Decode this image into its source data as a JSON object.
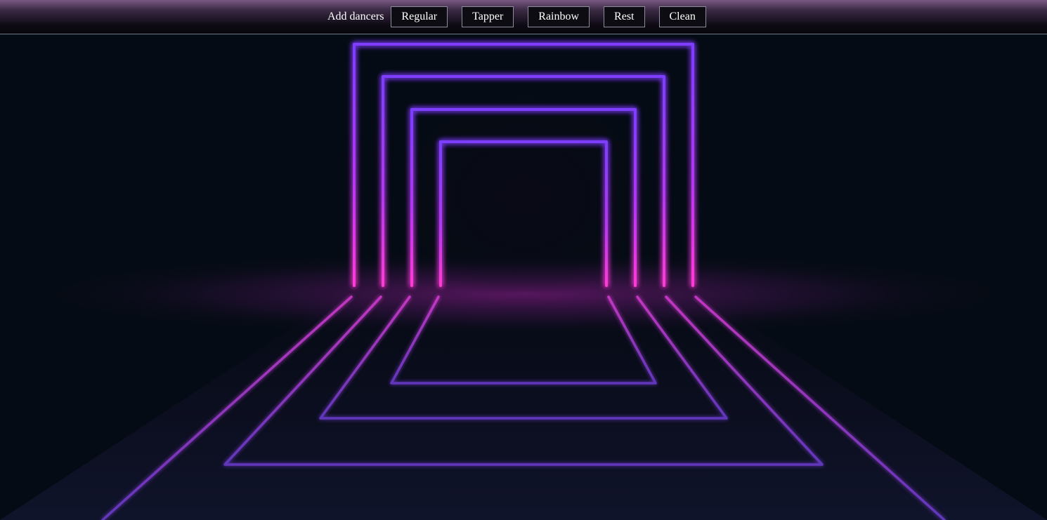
{
  "toolbar": {
    "add_label": "Add dancers",
    "buttons": {
      "regular": "Regular",
      "tapper": "Tapper",
      "rainbow": "Rainbow",
      "rest": "Rest",
      "clean": "Clean"
    }
  },
  "colors": {
    "background": "#050b14",
    "neon_magenta": "#ff3ad6",
    "neon_violet": "#8a3cff",
    "neon_purple": "#6a3acc"
  }
}
